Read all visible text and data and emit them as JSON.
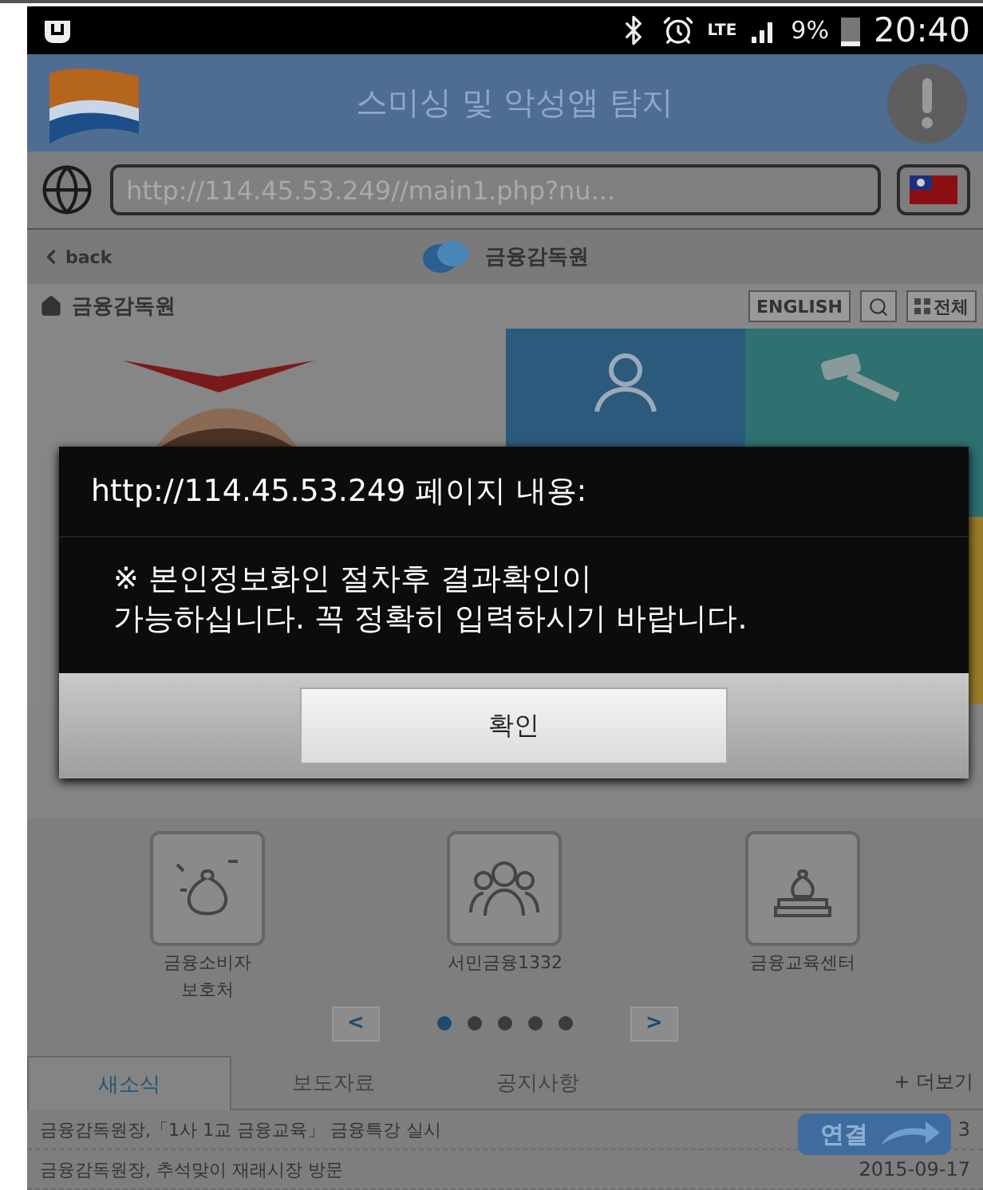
{
  "status_bar": {
    "network": "LTE",
    "battery": "9%",
    "time": "20:40"
  },
  "app_header": {
    "title": "스미싱 및 악성앱 탐지"
  },
  "url_bar": {
    "value": "http://114.45.53.249//main1.php?nu..."
  },
  "nav_bar": {
    "back": "back",
    "title": "금융감독원"
  },
  "site_header": {
    "home": "금융감독원",
    "buttons": [
      "ENGLISH",
      "전체"
    ]
  },
  "quick_links": [
    {
      "lines": [
        "금융소비자",
        "보호처"
      ],
      "kind": "money"
    },
    {
      "lines": [
        "서민금융1332"
      ],
      "kind": "people"
    },
    {
      "lines": [
        "금융교육센터"
      ],
      "kind": "books"
    }
  ],
  "pager": {
    "prev": "<",
    "next": ">",
    "dots": [
      {
        "selected": true
      },
      {
        "selected": false
      },
      {
        "selected": false
      },
      {
        "selected": false
      },
      {
        "selected": false
      }
    ]
  },
  "tabs": [
    {
      "label": "새소식",
      "selected": true
    },
    {
      "label": "보도자료",
      "selected": false
    },
    {
      "label": "공지사항",
      "selected": false
    }
  ],
  "more": "+ 더보기",
  "news": [
    {
      "title": "금융감독원장,「1사 1교 금융교육」 금융특강 실시",
      "date": "3"
    },
    {
      "title": "금융감독원장, 추석맞이 재래시장 방문",
      "date": "2015-09-17"
    }
  ],
  "link_badge": "연결",
  "dialog": {
    "title": "http://114.45.53.249 페이지 내용:",
    "message": "※ 본인정보화인 절차후 결과확인이 가능하십니다. 꼭 정확히 입력하시기 바랍니다.",
    "button": "확인"
  }
}
